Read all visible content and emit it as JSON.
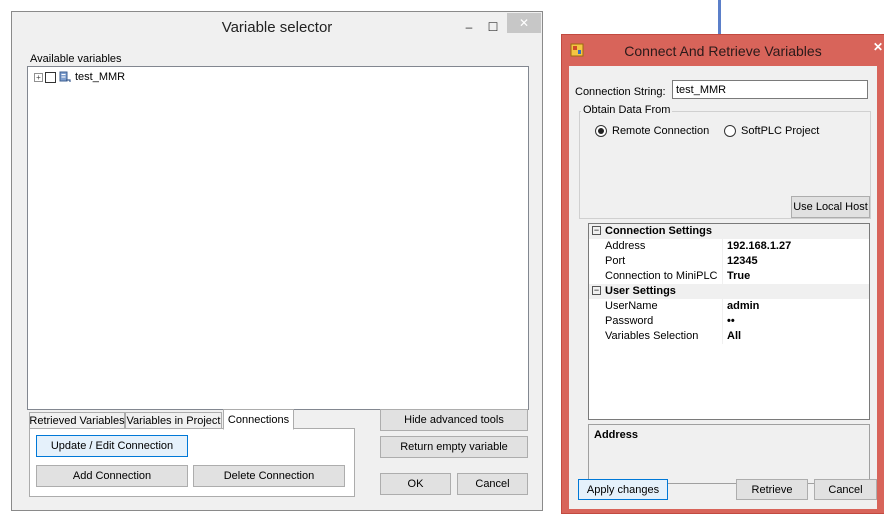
{
  "variable_selector": {
    "title": "Variable selector",
    "minimize_glyph": "–",
    "maximize_glyph": "☐",
    "close_glyph": "✕",
    "available_label": "Available variables",
    "tree_root_expander": "+",
    "tree_root_label": "test_MMR",
    "tabs": [
      {
        "label": "Retrieved Variables"
      },
      {
        "label": "Variables in Project"
      },
      {
        "label": "Connections"
      }
    ],
    "update_edit_button": "Update / Edit Connection",
    "add_connection_button": "Add Connection",
    "delete_connection_button": "Delete Connection",
    "hide_advanced_button": "Hide advanced tools",
    "return_empty_button": "Return empty variable",
    "ok_button": "OK",
    "cancel_button": "Cancel"
  },
  "connect_window": {
    "title": "Connect And Retrieve Variables",
    "close_glyph": "✕",
    "connection_string_label": "Connection String:",
    "connection_string_value": "test_MMR",
    "obtain_data_label": "Obtain Data From",
    "radio_remote": "Remote Connection",
    "radio_softplc": "SoftPLC Project",
    "use_local_host_button": "Use Local Host",
    "property_grid": {
      "connection_category": "Connection Settings",
      "connection_toggle": "−",
      "address_name": "Address",
      "address_value": "192.168.1.27",
      "port_name": "Port",
      "port_value": "12345",
      "minplc_name": "Connection to MiniPLC",
      "minplc_value": "True",
      "user_category": "User Settings",
      "user_toggle": "−",
      "username_name": "UserName",
      "username_value": "admin",
      "password_name": "Password",
      "password_value": "••",
      "varsel_name": "Variables Selection",
      "varsel_value": "All"
    },
    "description_title": "Address",
    "apply_button": "Apply changes",
    "retrieve_button": "Retrieve",
    "cancel_button": "Cancel"
  },
  "colors": {
    "window_bg": "#f0f0f0",
    "connect_frame": "#d8645a",
    "focus_border": "#0078d7"
  }
}
